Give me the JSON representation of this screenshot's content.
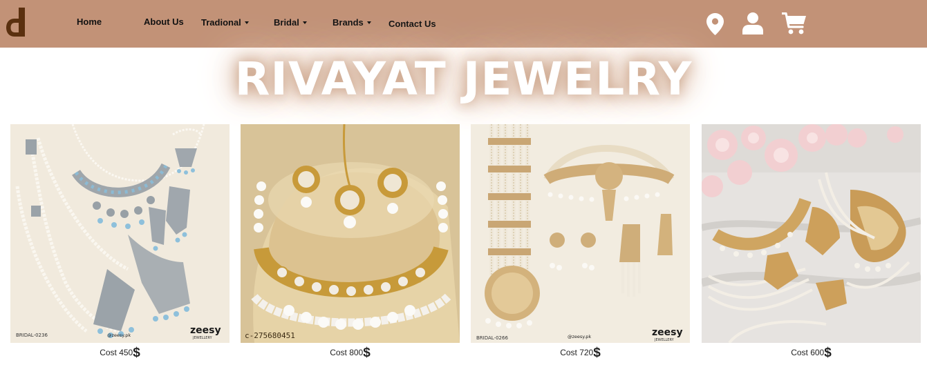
{
  "nav": {
    "links": [
      {
        "label": "Home",
        "dropdown": false
      },
      {
        "label": "About Us",
        "dropdown": false
      },
      {
        "label": "Tradional",
        "dropdown": true
      },
      {
        "label": "Bridal",
        "dropdown": true
      },
      {
        "label": "Brands",
        "dropdown": true
      },
      {
        "label": "Contact Us",
        "dropdown": false
      }
    ],
    "icons": [
      "location-pin-icon",
      "user-icon",
      "shopping-cart-icon"
    ]
  },
  "hero": {
    "title": "RIVAYAT JEWELRY"
  },
  "products": [
    {
      "price_label": "Cost 450",
      "currency": "$",
      "image_caption": "BRIDAL-0236",
      "image_handle": "@zeesy.pk",
      "image_brand": "zeesy",
      "image_brand_sub": "JEWELLERY"
    },
    {
      "price_label": "Cost 800",
      "currency": "$",
      "image_caption": "c-275680451"
    },
    {
      "price_label": "Cost 720",
      "currency": "$",
      "image_caption": "BRIDAL-0266",
      "image_handle": "@zeesy.pk",
      "image_brand": "zeesy",
      "image_brand_sub": "JEWELLERY"
    },
    {
      "price_label": "Cost 600",
      "currency": "$"
    }
  ],
  "colors": {
    "navbar": "#c29277",
    "logo": "#5a300f",
    "hero_glow": "#c9a186",
    "icon": "#ffffff"
  }
}
